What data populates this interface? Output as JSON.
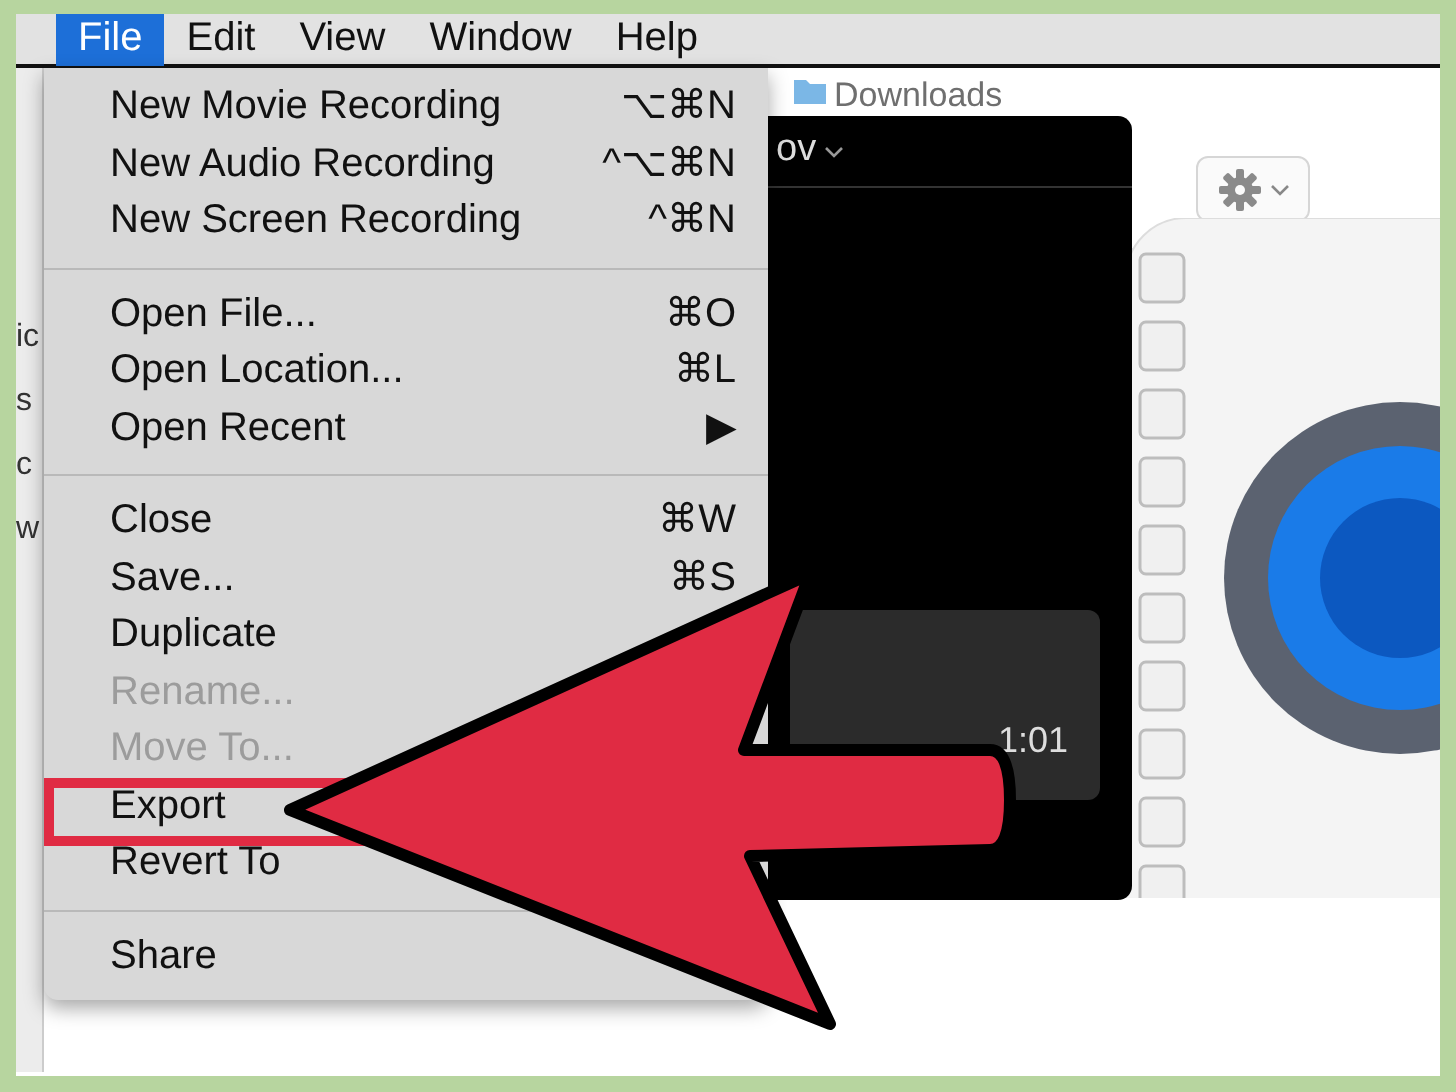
{
  "menu_bar": {
    "items": [
      {
        "label": "File",
        "selected": true
      },
      {
        "label": "Edit",
        "selected": false
      },
      {
        "label": "View",
        "selected": false
      },
      {
        "label": "Window",
        "selected": false
      },
      {
        "label": "Help",
        "selected": false
      }
    ]
  },
  "finder_window": {
    "location": "Downloads",
    "sidebar_fragments": [
      "ic",
      "s",
      "c",
      "w"
    ]
  },
  "player_window": {
    "title": "ov",
    "time": "1:01"
  },
  "file_menu": {
    "groups": [
      [
        {
          "label": "New Movie Recording",
          "shortcut": "⌥⌘N",
          "disabled": false,
          "annotated": false
        },
        {
          "label": "New Audio Recording",
          "shortcut": "^⌥⌘N",
          "disabled": false,
          "annotated": false
        },
        {
          "label": "New Screen Recording",
          "shortcut": "^⌘N",
          "disabled": false,
          "annotated": false
        }
      ],
      [
        {
          "label": "Open File...",
          "shortcut": "⌘O",
          "disabled": false,
          "annotated": false
        },
        {
          "label": "Open Location...",
          "shortcut": "⌘L",
          "disabled": false,
          "annotated": false
        },
        {
          "label": "Open Recent",
          "shortcut": "▶",
          "disabled": false,
          "annotated": false
        }
      ],
      [
        {
          "label": "Close",
          "shortcut": "⌘W",
          "disabled": false,
          "annotated": false
        },
        {
          "label": "Save...",
          "shortcut": "⌘S",
          "disabled": false,
          "annotated": false
        },
        {
          "label": "Duplicate",
          "disabled": false,
          "annotated": false
        },
        {
          "label": "Rename...",
          "disabled": true,
          "annotated": false
        },
        {
          "label": "Move To...",
          "disabled": true,
          "annotated": false
        },
        {
          "label": "Export",
          "disabled": false,
          "annotated": true
        },
        {
          "label": "Revert To",
          "disabled": false,
          "annotated": false
        }
      ],
      [
        {
          "label": "Share",
          "disabled": false,
          "annotated": false
        }
      ]
    ]
  }
}
